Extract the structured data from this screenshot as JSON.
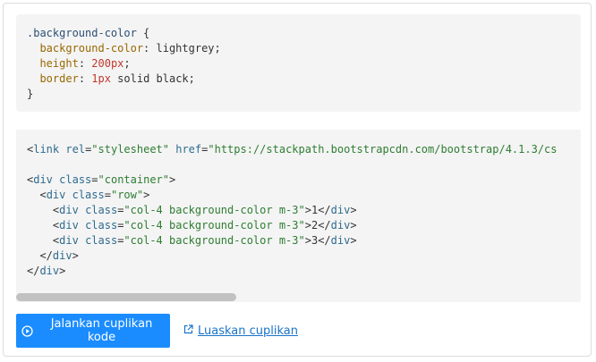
{
  "css_code": {
    "lines": [
      {
        "selector": ".background-color",
        "open": " {"
      },
      {
        "prop": "background-color",
        "value": "lightgrey",
        "prefix": "  ",
        "sep": ": ",
        "end": ";"
      },
      {
        "prop": "height",
        "value": "200px",
        "prefix": "  ",
        "sep": ": ",
        "end": ";"
      },
      {
        "prop": "border",
        "value_num": "1px",
        "value_rest": " solid black",
        "prefix": "  ",
        "sep": ": ",
        "end": ";"
      },
      {
        "close": "}"
      }
    ]
  },
  "html_code": {
    "line1": {
      "open": "<",
      "tag": "link",
      "sp1": " ",
      "attr1": "rel",
      "eq1": "=",
      "val1": "\"stylesheet\"",
      "sp2": " ",
      "attr2": "href",
      "eq2": "=",
      "val2": "\"https://stackpath.bootstrapcdn.com/bootstrap/4.1.3/cs"
    },
    "line3": {
      "open": "<",
      "tag": "div",
      "sp": " ",
      "attr": "class",
      "eq": "=",
      "val": "\"container\"",
      "close": ">"
    },
    "line4": {
      "indent": "  ",
      "open": "<",
      "tag": "div",
      "sp": " ",
      "attr": "class",
      "eq": "=",
      "val": "\"row\"",
      "close": ">"
    },
    "cols": [
      {
        "indent": "    ",
        "open": "<",
        "tag": "div",
        "sp": " ",
        "attr": "class",
        "eq": "=",
        "val": "\"col-4 background-color m-3\"",
        "close": ">",
        "text": "1",
        "end_open": "</",
        "end_tag": "div",
        "end_close": ">"
      },
      {
        "indent": "    ",
        "open": "<",
        "tag": "div",
        "sp": " ",
        "attr": "class",
        "eq": "=",
        "val": "\"col-4 background-color m-3\"",
        "close": ">",
        "text": "2",
        "end_open": "</",
        "end_tag": "div",
        "end_close": ">"
      },
      {
        "indent": "    ",
        "open": "<",
        "tag": "div",
        "sp": " ",
        "attr": "class",
        "eq": "=",
        "val": "\"col-4 background-color m-3\"",
        "close": ">",
        "text": "3",
        "end_open": "</",
        "end_tag": "div",
        "end_close": ">"
      }
    ],
    "line8": {
      "indent": "  ",
      "open": "</",
      "tag": "div",
      "close": ">"
    },
    "line9": {
      "open": "</",
      "tag": "div",
      "close": ">"
    }
  },
  "scrollbar": {
    "position_fraction": 0.0,
    "visible_fraction": 0.39
  },
  "actions": {
    "run_label": "Jalankan cuplikan kode",
    "expand_label": "Luaskan cuplikan"
  },
  "icons": {
    "run": "play-circle-icon",
    "expand": "external-link-icon"
  },
  "colors": {
    "accent": "#1a8cff",
    "link": "#1a73c7",
    "code_bg": "#f4f4f4"
  }
}
